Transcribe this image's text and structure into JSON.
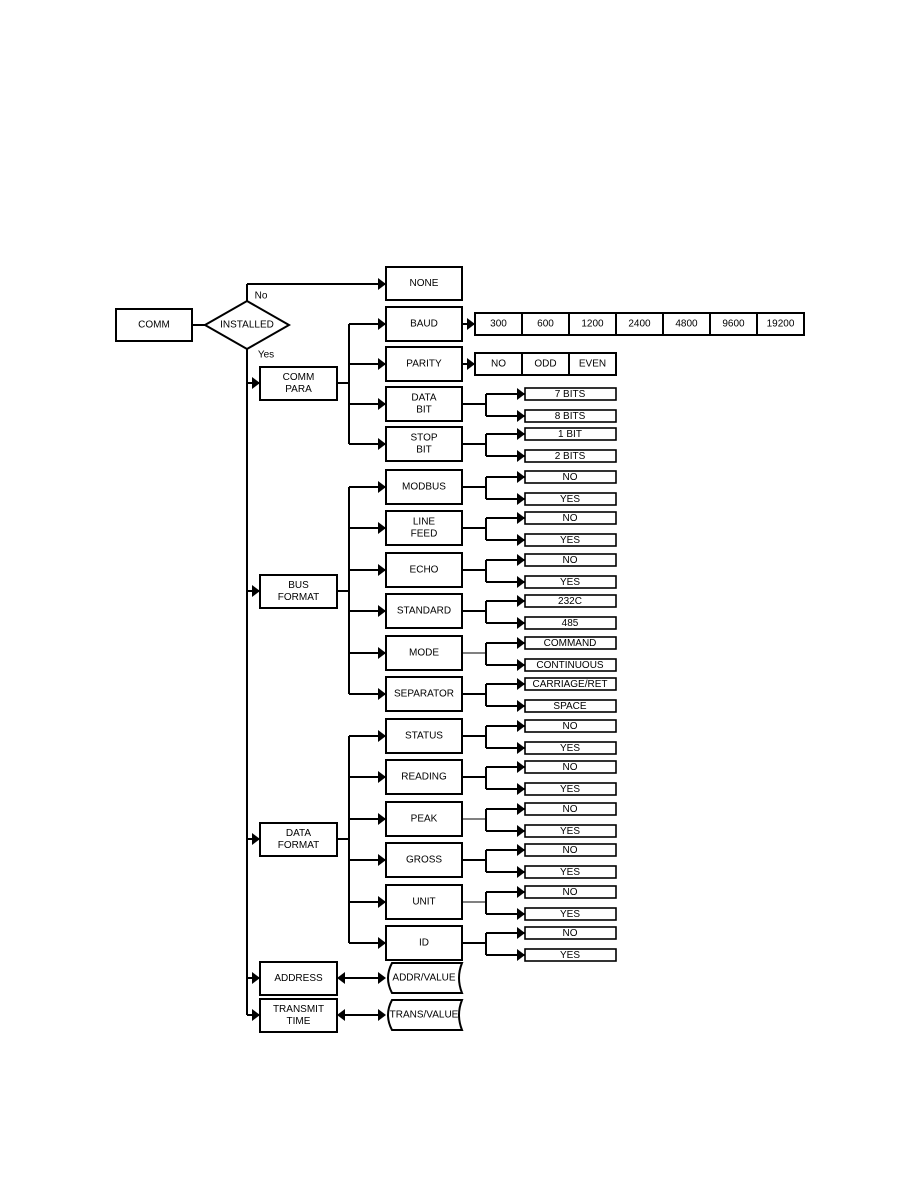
{
  "root": "COMM",
  "decision": {
    "label": "INSTALLED",
    "no_label": "No",
    "yes_label": "Yes",
    "no_target": "NONE"
  },
  "groups": [
    {
      "label": [
        "COMM",
        "PARA"
      ],
      "items": [
        {
          "label": [
            "BAUD"
          ],
          "inline_options": [
            "300",
            "600",
            "1200",
            "2400",
            "4800",
            "9600",
            "19200"
          ]
        },
        {
          "label": [
            "PARITY"
          ],
          "inline_options": [
            "NO",
            "ODD",
            "EVEN"
          ]
        },
        {
          "label": [
            "DATA",
            "BIT"
          ],
          "options": [
            "7 BITS",
            "8 BITS"
          ]
        },
        {
          "label": [
            "STOP",
            "BIT"
          ],
          "options": [
            "1 BIT",
            "2 BITS"
          ]
        }
      ]
    },
    {
      "label": [
        "BUS",
        "FORMAT"
      ],
      "items": [
        {
          "label": [
            "MODBUS"
          ],
          "options": [
            "NO",
            "YES"
          ]
        },
        {
          "label": [
            "LINE",
            "FEED"
          ],
          "options": [
            "NO",
            "YES"
          ]
        },
        {
          "label": [
            "ECHO"
          ],
          "options": [
            "NO",
            "YES"
          ]
        },
        {
          "label": [
            "STANDARD"
          ],
          "options": [
            "232C",
            "485"
          ]
        },
        {
          "label": [
            "MODE"
          ],
          "options": [
            "COMMAND",
            "CONTINUOUS"
          ]
        },
        {
          "label": [
            "SEPARATOR"
          ],
          "options": [
            "CARRIAGE/RET",
            "SPACE"
          ]
        }
      ]
    },
    {
      "label": [
        "DATA",
        "FORMAT"
      ],
      "items": [
        {
          "label": [
            "STATUS"
          ],
          "options": [
            "NO",
            "YES"
          ]
        },
        {
          "label": [
            "READING"
          ],
          "options": [
            "NO",
            "YES"
          ]
        },
        {
          "label": [
            "PEAK"
          ],
          "options": [
            "NO",
            "YES"
          ]
        },
        {
          "label": [
            "GROSS"
          ],
          "options": [
            "NO",
            "YES"
          ]
        },
        {
          "label": [
            "UNIT"
          ],
          "options": [
            "NO",
            "YES"
          ]
        },
        {
          "label": [
            "ID"
          ],
          "options": [
            "NO",
            "YES"
          ]
        }
      ]
    }
  ],
  "value_entries": [
    {
      "label": [
        "ADDRESS"
      ],
      "value": "ADDR/VALUE"
    },
    {
      "label": [
        "TRANSMIT",
        "TIME"
      ],
      "value": "TRANS/VALUE"
    }
  ]
}
